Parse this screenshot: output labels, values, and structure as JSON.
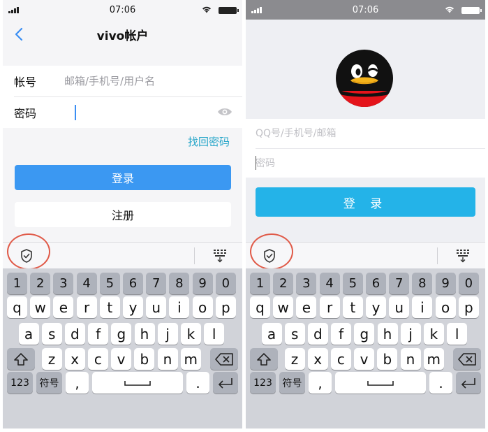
{
  "left": {
    "status": {
      "time": "07:06"
    },
    "nav": {
      "title": "vivo帐户"
    },
    "form": {
      "account_label": "帐号",
      "account_placeholder": "邮箱/手机号/用户名",
      "password_label": "密码",
      "password_value": ""
    },
    "forgot_link": "找回密码",
    "login_button": "登录",
    "register_button": "注册"
  },
  "right": {
    "status": {
      "time": "07:06"
    },
    "form": {
      "account_placeholder": "QQ号/手机号/邮箱",
      "password_placeholder": "密码"
    },
    "login_button": "登 录"
  },
  "keyboard": {
    "number_row": [
      "1",
      "2",
      "3",
      "4",
      "5",
      "6",
      "7",
      "8",
      "9",
      "0"
    ],
    "row_q": [
      "q",
      "w",
      "e",
      "r",
      "t",
      "y",
      "u",
      "i",
      "o",
      "p"
    ],
    "row_a": [
      "a",
      "s",
      "d",
      "f",
      "g",
      "h",
      "j",
      "k",
      "l"
    ],
    "row_z": [
      "z",
      "x",
      "c",
      "v",
      "b",
      "n",
      "m"
    ],
    "mode_123": "123",
    "symbols": "符号",
    "comma": ",",
    "period": "."
  },
  "colors": {
    "vivo_login_button": "#3b98f2",
    "qq_login_button": "#24b3e8",
    "link": "#27a6c9",
    "highlight_ring": "#e05a48"
  },
  "icons": {
    "back": "chevron-left-icon",
    "eye": "eye-icon",
    "shield": "shield-check-icon",
    "collapse": "keyboard-collapse-icon",
    "shift": "shift-icon",
    "backspace": "backspace-icon",
    "space": "space-icon",
    "return": "return-icon",
    "logo": "qq-penguin-logo"
  }
}
